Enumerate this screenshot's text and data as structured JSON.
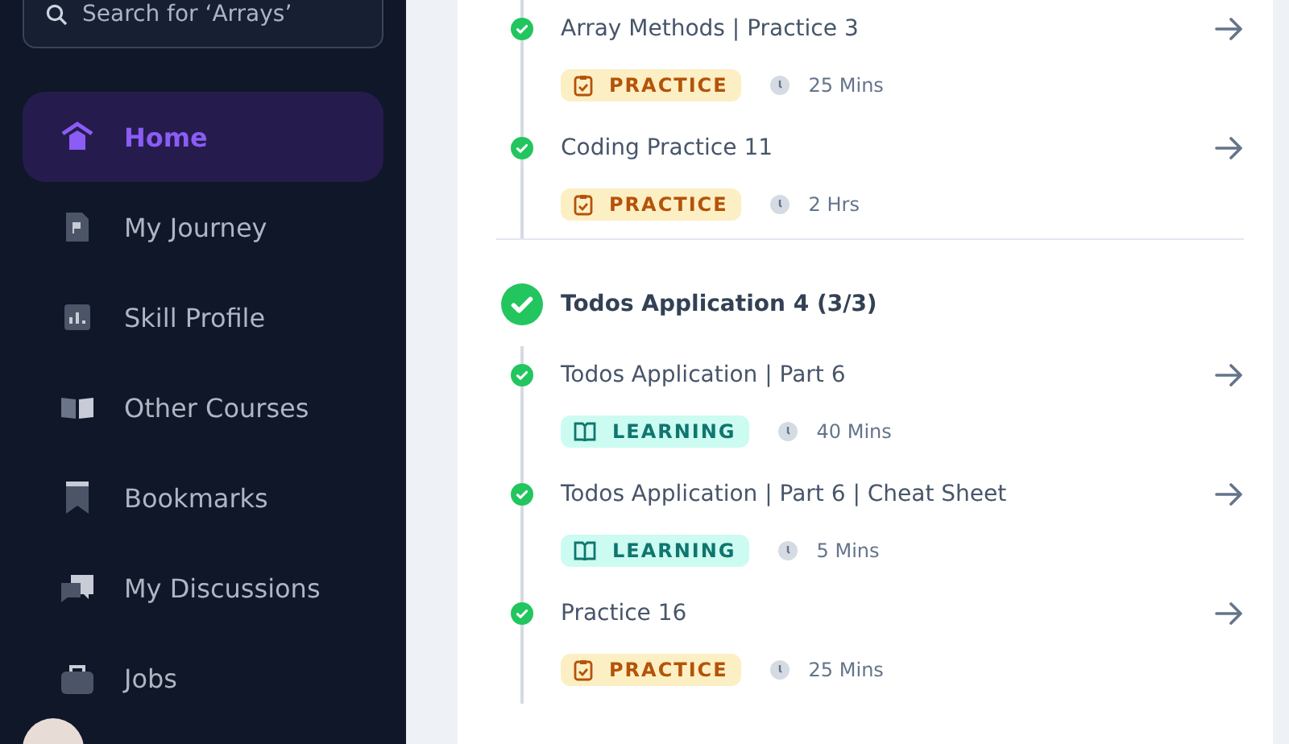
{
  "sidebar": {
    "search": {
      "placeholder": "Search for ‘Arrays’"
    },
    "items": [
      {
        "label": "Home",
        "kind": "home",
        "selected": true
      },
      {
        "label": "My Journey",
        "kind": "journey",
        "selected": false
      },
      {
        "label": "Skill Profile",
        "kind": "chart",
        "selected": false
      },
      {
        "label": "Other Courses",
        "kind": "book",
        "selected": false
      },
      {
        "label": "Bookmarks",
        "kind": "bookmark",
        "selected": false
      },
      {
        "label": "My Discussions",
        "kind": "chat",
        "selected": false
      },
      {
        "label": "Jobs",
        "kind": "bag",
        "selected": false
      }
    ]
  },
  "sections": [
    {
      "items": [
        {
          "title": "Array Methods | Practice 3",
          "kind": "practice",
          "tag": "PRACTICE",
          "duration": "25 Mins",
          "completed": true
        },
        {
          "title": "Coding Practice 11",
          "kind": "practice",
          "tag": "PRACTICE",
          "duration": "2 Hrs",
          "completed": true
        }
      ]
    },
    {
      "title": "Todos Application 4 (3/3)",
      "completed": true,
      "items": [
        {
          "title": "Todos Application | Part 6",
          "kind": "learning",
          "tag": "LEARNING",
          "duration": "40 Mins",
          "completed": true
        },
        {
          "title": "Todos Application | Part 6 | Cheat Sheet",
          "kind": "learning",
          "tag": "LEARNING",
          "duration": "5 Mins",
          "completed": true
        },
        {
          "title": "Practice 16",
          "kind": "practice",
          "tag": "PRACTICE",
          "duration": "25 Mins",
          "completed": true
        }
      ]
    }
  ]
}
